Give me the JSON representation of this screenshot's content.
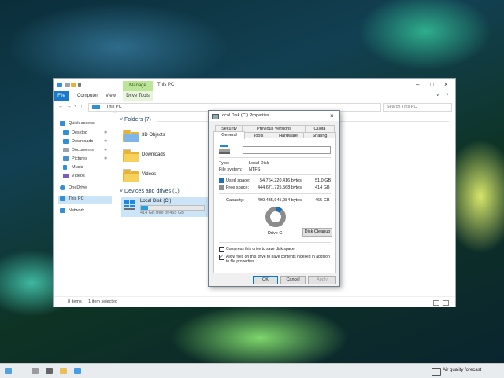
{
  "explorer": {
    "title": "This PC",
    "manage_tab": "Manage",
    "ribbon_tabs": [
      "File",
      "Computer",
      "View"
    ],
    "drive_tools": "Drive Tools",
    "address": "This PC",
    "search_placeholder": "Search This PC",
    "nav": {
      "quick_access": "Quick access",
      "items": [
        "Desktop",
        "Downloads",
        "Documents",
        "Pictures",
        "Music",
        "Videos"
      ],
      "onedrive": "OneDrive",
      "this_pc": "This PC",
      "network": "Network"
    },
    "folders_header": "Folders (7)",
    "folders": [
      "3D Objects",
      "Downloads",
      "Videos"
    ],
    "drives_header": "Devices and drives (1)",
    "drive": {
      "name": "Local Disk (C:)",
      "free_text": "414 GB free of 465 GB",
      "used_fraction": 0.11
    },
    "status": {
      "items": "8 items",
      "selected": "1 item selected"
    }
  },
  "dialog": {
    "title": "Local Disk (C:) Properties",
    "tabs_top": [
      "Security",
      "Previous Versions",
      "Quota"
    ],
    "tabs_bottom": [
      "General",
      "Tools",
      "Hardware",
      "Sharing"
    ],
    "type_label": "Type:",
    "type_value": "Local Disk",
    "fs_label": "File system:",
    "fs_value": "NTFS",
    "used_label": "Used space:",
    "used_bytes": "54,764,220,416 bytes",
    "used_gb": "51.0 GB",
    "free_label": "Free space:",
    "free_bytes": "444,671,725,568 bytes",
    "free_gb": "414 GB",
    "capacity_label": "Capacity:",
    "capacity_bytes": "499,435,945,984 bytes",
    "capacity_gb": "465 GB",
    "drive_label": "Drive C:",
    "disk_cleanup": "Disk Cleanup",
    "compress_label": "Compress this drive to save disk space",
    "index_label": "Allow files on this drive to have contents indexed in addition to file properties",
    "ok": "OK",
    "cancel": "Cancel",
    "apply": "Apply",
    "used_color": "#1f6fb5",
    "free_color": "#8c8c8c"
  },
  "taskbar": {
    "air_quality": "Air quality forecast"
  }
}
